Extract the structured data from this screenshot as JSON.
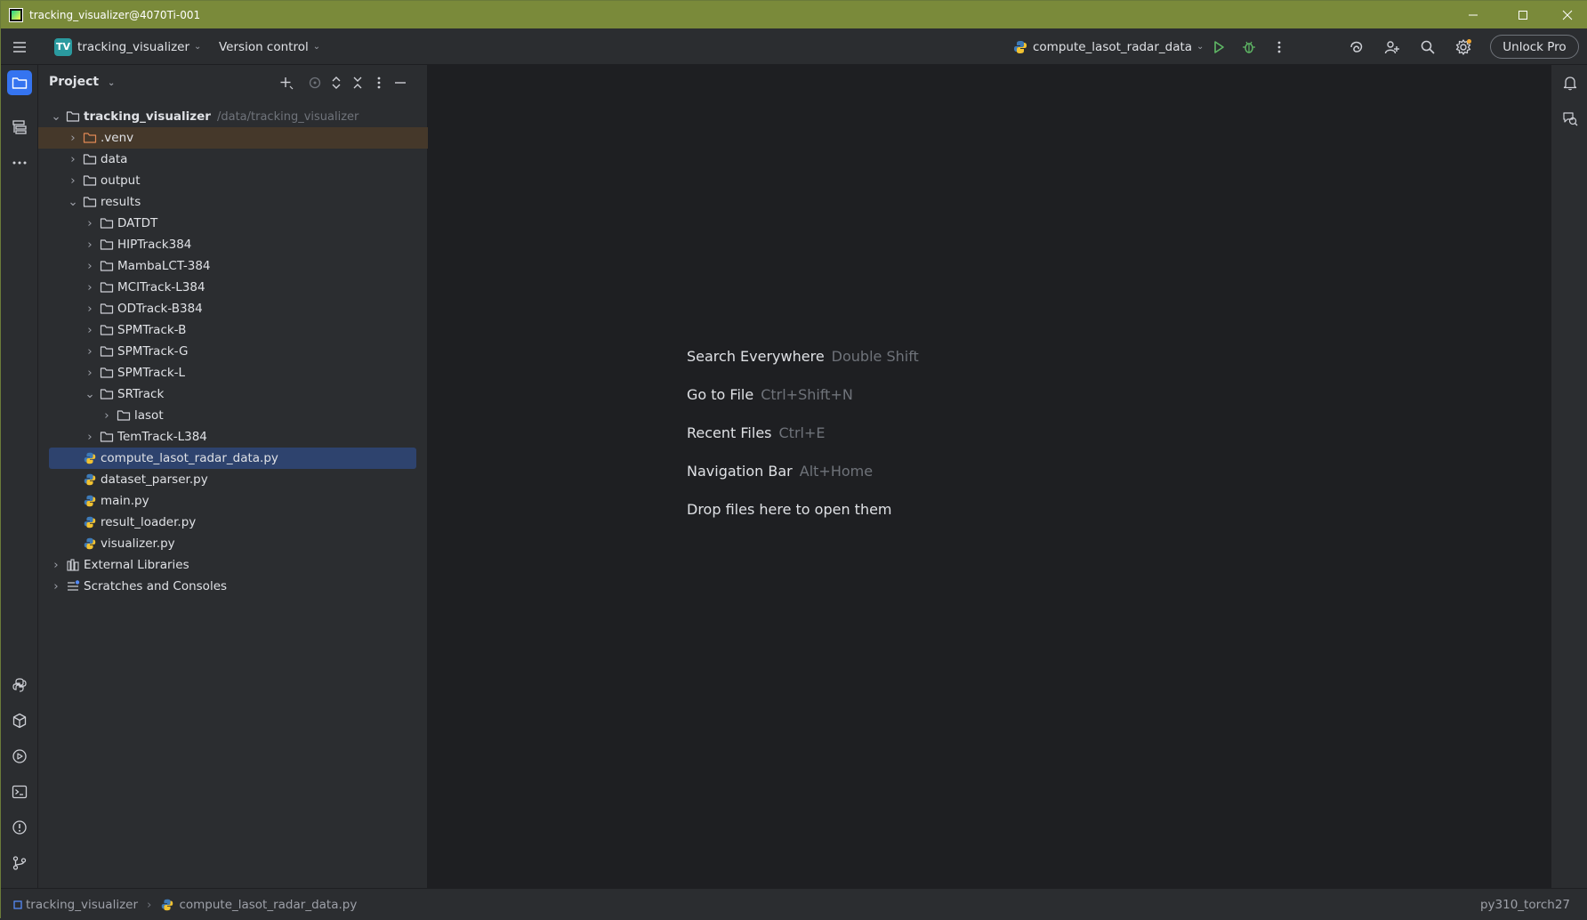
{
  "window": {
    "title": "tracking_visualizer@4070Ti-001"
  },
  "toolbar": {
    "project_badge": "TV",
    "project_name": "tracking_visualizer",
    "vcs_label": "Version control",
    "run_config": "compute_lasot_radar_data",
    "unlock_label": "Unlock Pro"
  },
  "project_panel": {
    "title": "Project",
    "root": {
      "name": "tracking_visualizer",
      "path": "/data/tracking_visualizer"
    },
    "items": [
      {
        "label": ".venv",
        "kind": "folder-excluded"
      },
      {
        "label": "data",
        "kind": "folder"
      },
      {
        "label": "output",
        "kind": "folder"
      },
      {
        "label": "results",
        "kind": "folder"
      },
      {
        "label": "DATDT",
        "kind": "folder"
      },
      {
        "label": "HIPTrack384",
        "kind": "folder"
      },
      {
        "label": "MambaLCT-384",
        "kind": "folder"
      },
      {
        "label": "MCITrack-L384",
        "kind": "folder"
      },
      {
        "label": "ODTrack-B384",
        "kind": "folder"
      },
      {
        "label": "SPMTrack-B",
        "kind": "folder"
      },
      {
        "label": "SPMTrack-G",
        "kind": "folder"
      },
      {
        "label": "SPMTrack-L",
        "kind": "folder"
      },
      {
        "label": "SRTrack",
        "kind": "folder"
      },
      {
        "label": "lasot",
        "kind": "folder"
      },
      {
        "label": "TemTrack-L384",
        "kind": "folder"
      },
      {
        "label": "compute_lasot_radar_data.py",
        "kind": "python"
      },
      {
        "label": "dataset_parser.py",
        "kind": "python"
      },
      {
        "label": "main.py",
        "kind": "python"
      },
      {
        "label": "result_loader.py",
        "kind": "python"
      },
      {
        "label": "visualizer.py",
        "kind": "python"
      },
      {
        "label": "External Libraries",
        "kind": "library"
      },
      {
        "label": "Scratches and Consoles",
        "kind": "scratches"
      }
    ]
  },
  "editor_hints": [
    {
      "action": "Search Everywhere",
      "shortcut": "Double Shift"
    },
    {
      "action": "Go to File",
      "shortcut": "Ctrl+Shift+N"
    },
    {
      "action": "Recent Files",
      "shortcut": "Ctrl+E"
    },
    {
      "action": "Navigation Bar",
      "shortcut": "Alt+Home"
    },
    {
      "action": "Drop files here to open them",
      "shortcut": ""
    }
  ],
  "statusbar": {
    "breadcrumb_project": "tracking_visualizer",
    "breadcrumb_file": "compute_lasot_radar_data.py",
    "interpreter": "py310_torch27"
  },
  "colors": {
    "titlebar": "#7a8a3a",
    "accent": "#3574f0",
    "selection": "#2e436e",
    "excluded_row": "#45382a",
    "run_green": "#5fb865"
  }
}
